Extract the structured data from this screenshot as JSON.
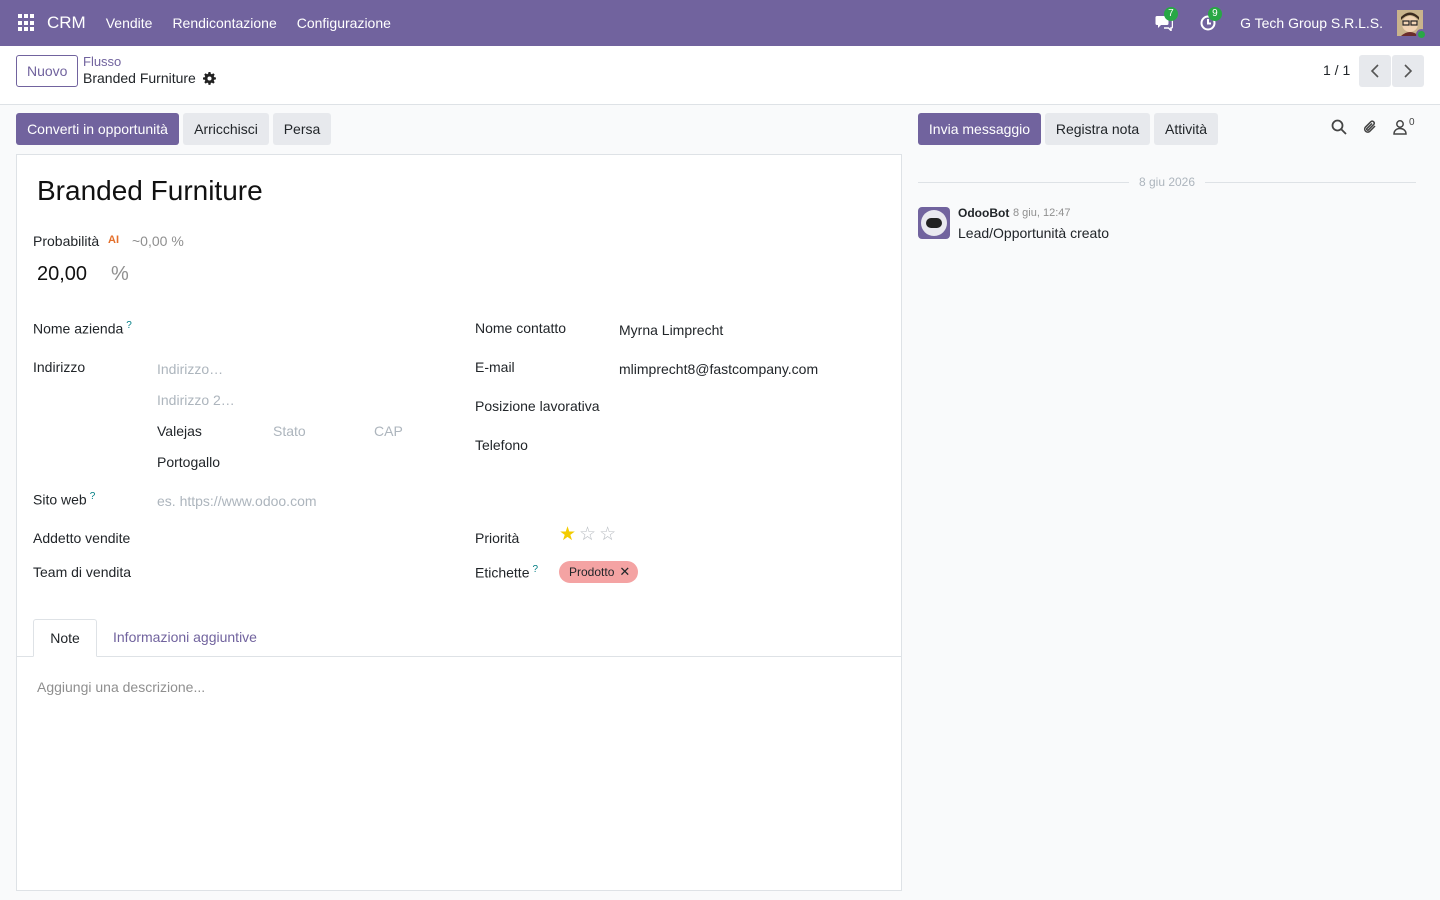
{
  "navbar": {
    "brand": "CRM",
    "menus": [
      "Vendite",
      "Rendicontazione",
      "Configurazione"
    ],
    "messages_count": "7",
    "activities_count": "9",
    "company": "G Tech Group S.R.L.S.",
    "accent_color": "#71639e"
  },
  "control": {
    "new_label": "Nuovo",
    "breadcrumb_parent": "Flusso",
    "breadcrumb_current": "Branded Furniture",
    "pager": "1 / 1"
  },
  "form_buttons": {
    "convert": "Converti in opportunità",
    "enrich": "Arricchisci",
    "lost": "Persa"
  },
  "chatter_buttons": {
    "send_message": "Invia messaggio",
    "log_note": "Registra nota",
    "activities": "Attività",
    "followers_count": "0"
  },
  "form": {
    "title": "Branded Furniture",
    "probability_label": "Probabilità",
    "ai_label": "AI",
    "ai_probability": "~0,00 %",
    "probability_value": "20,00",
    "percent_sign": "%",
    "company_label": "Nome azienda",
    "address_label": "Indirizzo",
    "street_placeholder": "Indirizzo…",
    "street2_placeholder": "Indirizzo 2…",
    "city": "Valejas",
    "state_placeholder": "Stato",
    "zip_placeholder": "CAP",
    "country": "Portogallo",
    "website_label": "Sito web",
    "website_placeholder": "es. https://www.odoo.com",
    "salesperson_label": "Addetto vendite",
    "sales_team_label": "Team di vendita",
    "contact_label": "Nome contatto",
    "contact_value": "Myrna Limprecht",
    "email_label": "E-mail",
    "email_value": "mlimprecht8@fastcompany.com",
    "job_label": "Posizione lavorativa",
    "phone_label": "Telefono",
    "priority_label": "Priorità",
    "priority_stars": 1,
    "priority_max": 3,
    "tags_label": "Etichette",
    "tag_value": "Prodotto",
    "help_mark": "?"
  },
  "tabs": {
    "note": "Note",
    "extra": "Informazioni aggiuntive"
  },
  "description_placeholder": "Aggiungi una descrizione...",
  "chatter": {
    "date": "8 giu 2026",
    "author": "OdooBot",
    "message_date": "8 giu, 12:47",
    "message": "Lead/Opportunità creato"
  },
  "colors": {
    "star_filled": "#f3cc00",
    "star_empty": "#b8bcc2",
    "tag_bg": "#f4a3a3"
  }
}
